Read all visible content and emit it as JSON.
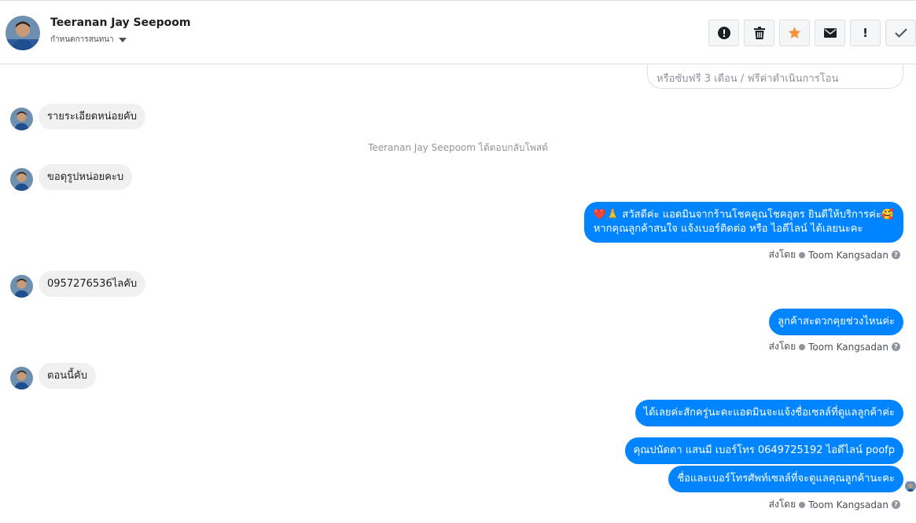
{
  "header": {
    "name": "Teeranan Jay Seepoom",
    "subtitle": "กำหนดการสนทนา"
  },
  "toolbar": {
    "buttons": [
      {
        "icon": "alert-circle-icon"
      },
      {
        "icon": "trash-icon"
      },
      {
        "icon": "star-icon",
        "color": "#f7923b"
      },
      {
        "icon": "envelope-icon"
      },
      {
        "icon": "exclamation-icon"
      },
      {
        "icon": "checkmark-icon"
      }
    ],
    "exclamation_glyph": "!"
  },
  "ad_card": {
    "text": "หรือซับฟรี 3 เดือน / ฟรีค่าดำเนินการโอน"
  },
  "messages": {
    "in_1": "รายระเอียดหน่อยคับ",
    "system_note": "Teeranan Jay Seepoom ได้ตอบกลับโพสต์",
    "in_2": "ขอดุรูปหน่อยคะบ",
    "out_1_line1": "❤️🙏 สวัสดีค่ะ แอดมินจากร้านโชคคูณโชคอุดร ยินดีให้บริการค่ะ🥰",
    "out_1_line2": "หากคุณลูกค้าสนใจ แจ้งเบอร์ติดต่อ หรือ ไอดีไลน์ ได้เลยนะคะ",
    "in_3": "0957276536ไลคับ",
    "out_2": "ลูกค้าสะดวกคุยช่วงไหนค่ะ",
    "in_4": "ตอนนี้คับ",
    "out_3": "ได้เลยค่ะสักครู่นะคะแอดมินจะแจ้งชื่อเซลล์ที่ดูแลลูกค้าค่ะ",
    "out_4": "คุณปนัดดา แสนมี   เบอร์โทร 0649725192  ไอดีไลน์ poofp",
    "out_5": "ชื่อและเบอร์โทรศัพท์เซลล์ที่จะดูแลคุณลูกค้านะคะ"
  },
  "sent_by": {
    "prefix": "ส่งโดย",
    "agent": "Toom Kangsadan",
    "help_glyph": "?"
  },
  "colors": {
    "outgoing_bubble": "#0084ff",
    "incoming_bubble": "#f1f0f0"
  }
}
